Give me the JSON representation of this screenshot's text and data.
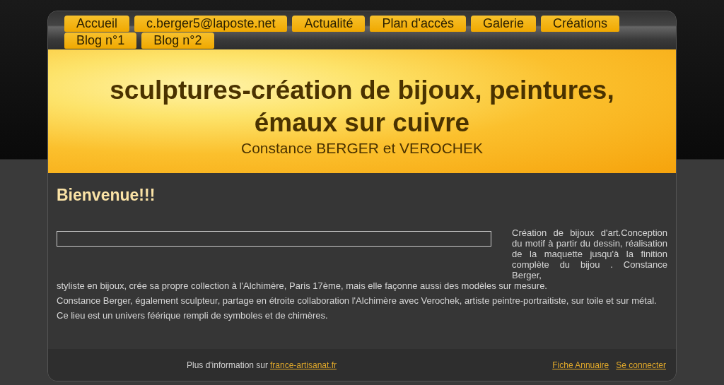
{
  "nav": {
    "items": [
      {
        "label": "Accueil"
      },
      {
        "label": "c.berger5@laposte.net"
      },
      {
        "label": "Actualité"
      },
      {
        "label": "Plan d'accès"
      },
      {
        "label": "Galerie"
      },
      {
        "label": "Créations"
      },
      {
        "label": "Blog n°1"
      },
      {
        "label": "Blog n°2"
      }
    ]
  },
  "banner": {
    "title": "sculptures-création de bijoux, peintures, émaux sur cuivre",
    "subtitle": "Constance BERGER et VEROCHEK"
  },
  "content": {
    "heading": "Bienvenue!!!",
    "intro": "Création de bijoux d'art.Conception du motif à partir du dessin, réalisation de la maquette jusqu'à la finition complète du bijou . Constance Berger,",
    "paragraphs": [
      "styliste en bijoux, crée sa propre collection à l'Alchimère, Paris 17ème, mais elle façonne aussi des modèles sur mesure.",
      "Constance Berger, également sculpteur, partage en étroite collaboration l'Alchimère avec Verochek, artiste peintre-portraitiste, sur toile et sur métal.",
      "Ce lieu est un univers féérique rempli de symboles et de chimères."
    ]
  },
  "footer": {
    "info": "Plus d'information sur",
    "info_link": "france-artisanat.fr",
    "links": [
      "Fiche Annuaire",
      "Se connecter"
    ]
  }
}
